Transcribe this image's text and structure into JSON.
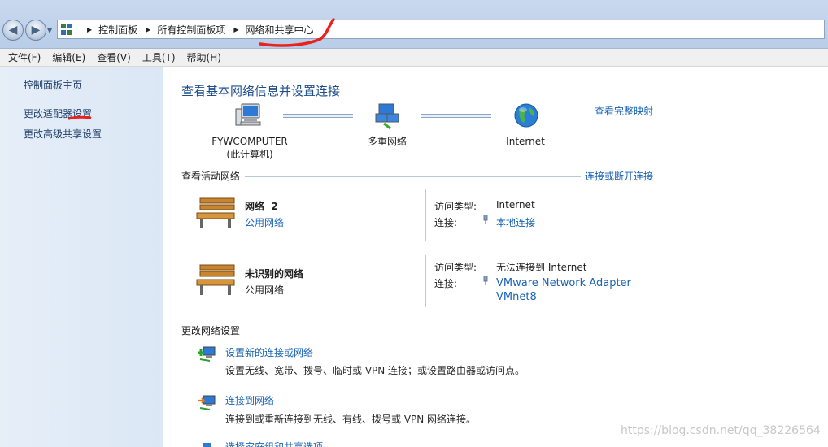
{
  "address": {
    "crumbs": [
      "控制面板",
      "所有控制面板项",
      "网络和共享中心"
    ]
  },
  "menu": [
    "文件(F)",
    "编辑(E)",
    "查看(V)",
    "工具(T)",
    "帮助(H)"
  ],
  "sidebar": {
    "items": [
      {
        "label": "控制面板主页"
      },
      {
        "label": "更改适配器设置"
      },
      {
        "label": "更改高级共享设置"
      }
    ]
  },
  "main": {
    "title": "查看基本网络信息并设置连接",
    "map_link": "查看完整映射",
    "nodes": [
      {
        "line1": "FYWCOMPUTER",
        "line2": "(此计算机)"
      },
      {
        "line1": "多重网络"
      },
      {
        "line1": "Internet"
      }
    ],
    "active_header": "查看活动网络",
    "active_link": "连接或断开连接",
    "networks": [
      {
        "name": "网络  2",
        "type": "公用网络",
        "access_label": "访问类型:",
        "access_value": "Internet",
        "conn_label": "连接:",
        "conn_value": "本地连接"
      },
      {
        "name": "未识别的网络",
        "type": "公用网络",
        "access_label": "访问类型:",
        "access_value": "无法连接到 Internet",
        "conn_label": "连接:",
        "conn_value": "VMware Network Adapter",
        "conn_value2": "VMnet8"
      }
    ],
    "change_header": "更改网络设置",
    "tasks": [
      {
        "title": "设置新的连接或网络",
        "desc": "设置无线、宽带、拨号、临时或 VPN 连接；或设置路由器或访问点。"
      },
      {
        "title": "连接到网络",
        "desc": "连接到或重新连接到无线、有线、拨号或 VPN 网络连接。"
      },
      {
        "title": "选择家庭组和共享选项"
      }
    ]
  },
  "watermark": "https://blog.csdn.net/qq_38226564"
}
